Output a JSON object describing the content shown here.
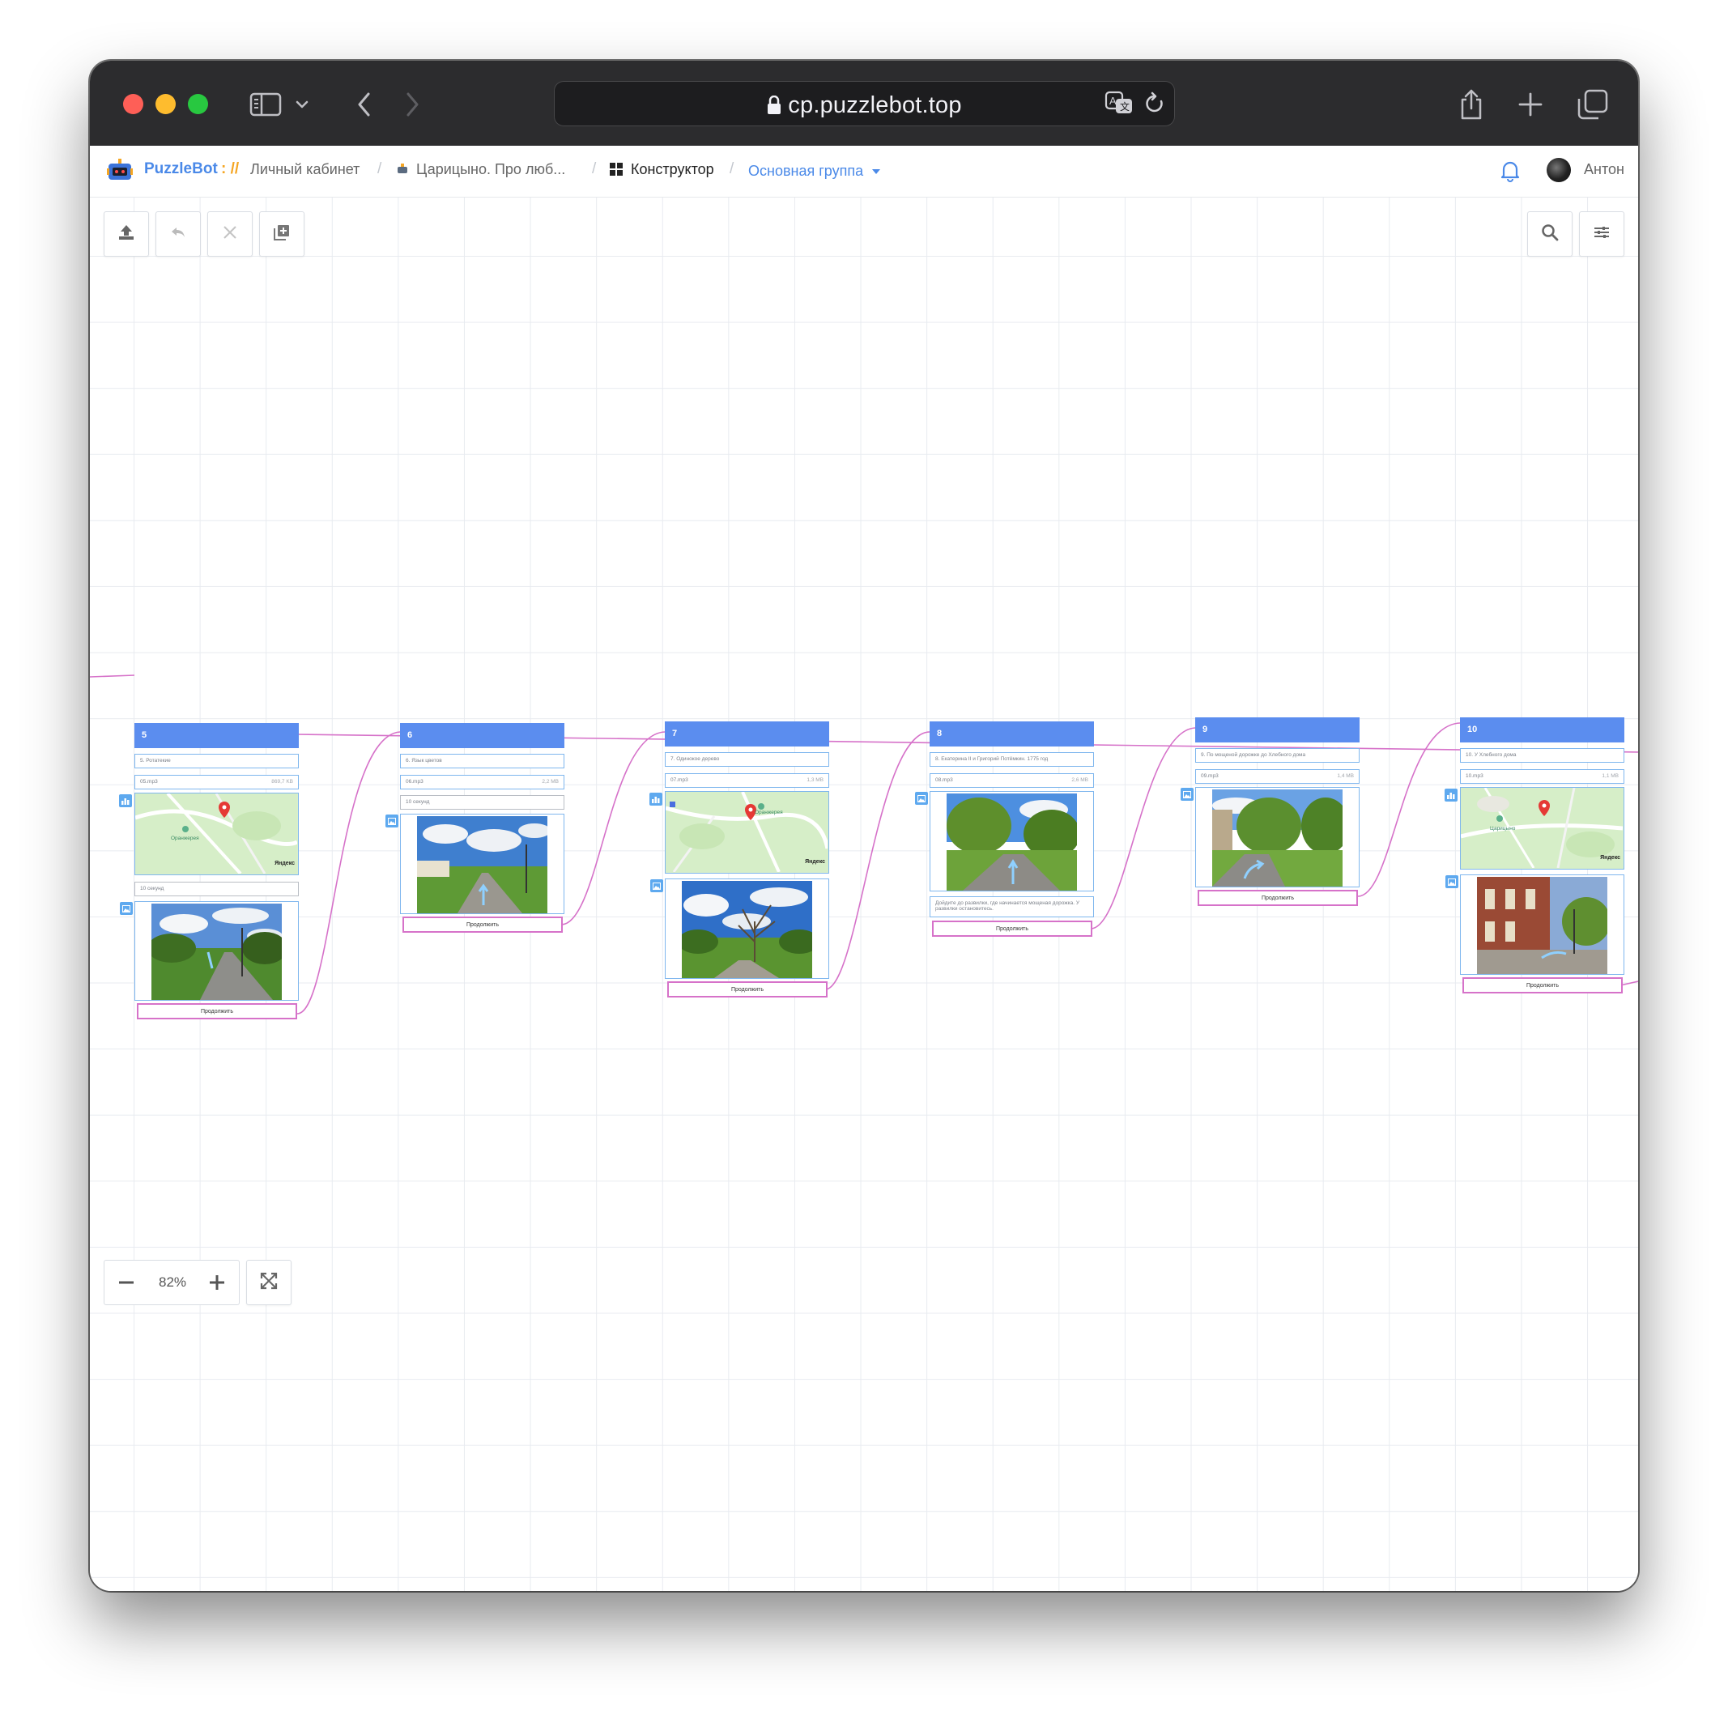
{
  "browser": {
    "url": "cp.puzzlebot.top"
  },
  "app": {
    "brand": "PuzzleBot",
    "brand_sep": ":",
    "breadcrumbs": {
      "cabinet": "Личный кабинет",
      "project": "Царицыно. Про люб...",
      "constructor": "Конструктор",
      "group": "Основная группа"
    },
    "user": "Антон"
  },
  "zoom": {
    "level": "82%"
  },
  "nodes": [
    {
      "id": "5",
      "text": "5. Ротатекие",
      "audio": "05.mp3",
      "audio_size": "869,7 KB",
      "map_label": "Оранжерея",
      "map_brand": "Яндекс",
      "delay": "10 секунд",
      "button": "Продолжить"
    },
    {
      "id": "6",
      "text": "6. Язык цветов",
      "audio": "06.mp3",
      "audio_size": "2,2 MB",
      "delay": "10 секунд",
      "button": "Продолжить"
    },
    {
      "id": "7",
      "text": "7. Одинокое дерево",
      "audio": "07.mp3",
      "audio_size": "1,3 MB",
      "map_label": "Оранжерея",
      "map_brand": "Яндекс",
      "button": "Продолжить"
    },
    {
      "id": "8",
      "text": "8. Екатерина II и Григорий Потёмкин. 1775 год",
      "audio": "08.mp3",
      "audio_size": "2,6 MB",
      "note": "Дойдите до развилки, где начинается мощеная дорожка. У развилки остановитесь.",
      "button": "Продолжить"
    },
    {
      "id": "9",
      "text": "9. По мощеной дорожке до Хлебного дома",
      "audio": "09.mp3",
      "audio_size": "1,4 MB",
      "button": "Продолжить"
    },
    {
      "id": "10",
      "text": "10. У Хлебного дома",
      "audio": "10.mp3",
      "audio_size": "1,1 MB",
      "map_label": "Царицыно",
      "map_brand": "Яндекс",
      "button": "Продолжить"
    }
  ],
  "colors": {
    "node_header": "#5b8def",
    "row_border": "#7eb6ee",
    "connector": "#d672c9",
    "brand_blue": "#4a89e8",
    "brand_orange": "#f5a623"
  },
  "icons": [
    "sidebar-icon",
    "chevron-down-icon",
    "back-icon",
    "forward-icon",
    "lock-icon",
    "translate-icon",
    "reload-icon",
    "share-icon",
    "plus-icon",
    "tabs-icon",
    "bell-icon",
    "upload-icon",
    "undo-icon",
    "delete-icon",
    "add-copy-icon",
    "search-icon",
    "settings-icon",
    "zoom-out-icon",
    "zoom-in-icon",
    "fit-screen-icon"
  ]
}
